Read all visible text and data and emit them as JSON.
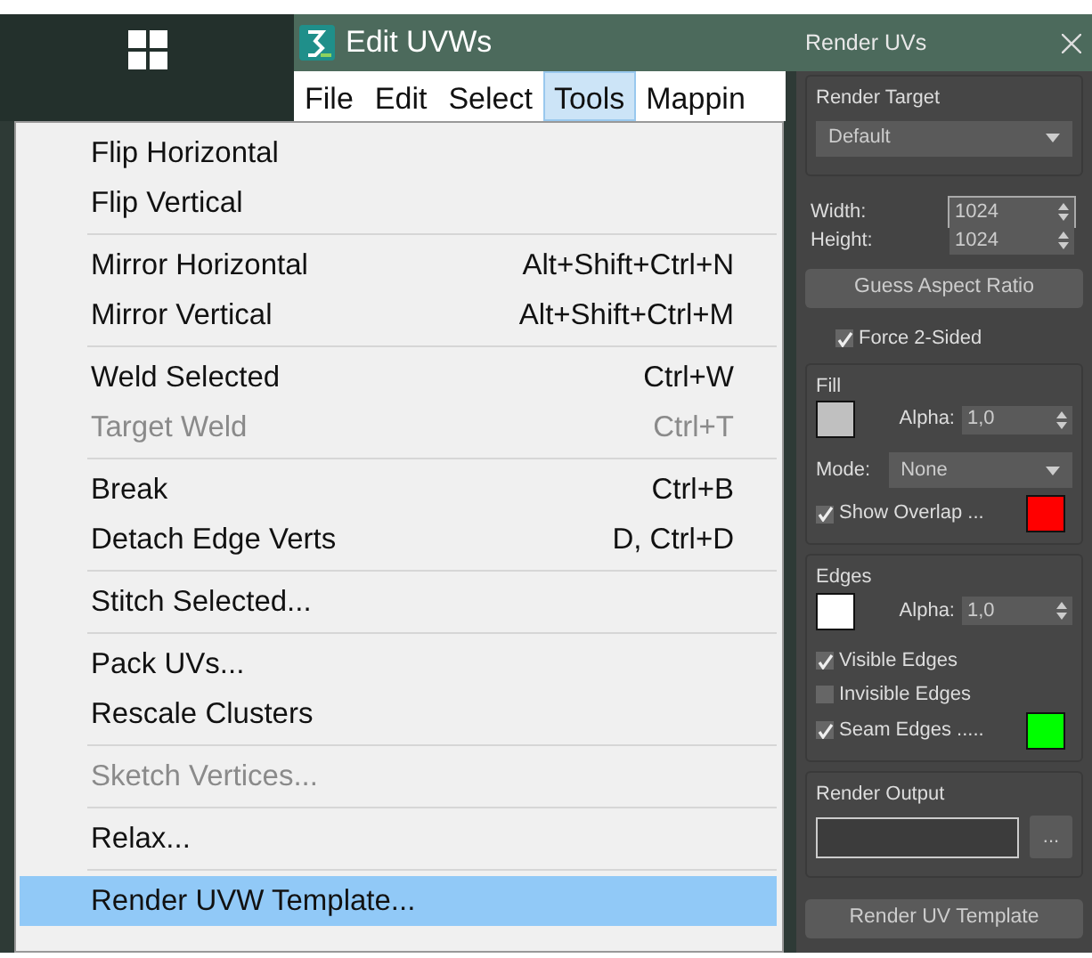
{
  "app_window": {
    "title": "Edit UVWs",
    "menu_bar": [
      {
        "label": "File",
        "selected": false
      },
      {
        "label": "Edit",
        "selected": false
      },
      {
        "label": "Select",
        "selected": false
      },
      {
        "label": "Tools",
        "selected": true
      },
      {
        "label": "Mappin",
        "selected": false
      }
    ]
  },
  "tools_menu": [
    {
      "kind": "item",
      "label": "Flip Horizontal",
      "disabled": false,
      "selected": false
    },
    {
      "kind": "item",
      "label": "Flip Vertical",
      "disabled": false,
      "selected": false
    },
    {
      "kind": "separator"
    },
    {
      "kind": "item",
      "label": "Mirror Horizontal",
      "shortcut": "Alt+Shift+Ctrl+N",
      "disabled": false,
      "selected": false
    },
    {
      "kind": "item",
      "label": "Mirror Vertical",
      "shortcut": "Alt+Shift+Ctrl+M",
      "disabled": false,
      "selected": false
    },
    {
      "kind": "separator"
    },
    {
      "kind": "item",
      "label": "Weld Selected",
      "shortcut": "Ctrl+W",
      "disabled": false,
      "selected": false
    },
    {
      "kind": "item",
      "label": "Target Weld",
      "shortcut": "Ctrl+T",
      "disabled": true,
      "selected": false
    },
    {
      "kind": "separator"
    },
    {
      "kind": "item",
      "label": "Break",
      "shortcut": "Ctrl+B",
      "disabled": false,
      "selected": false
    },
    {
      "kind": "item",
      "label": "Detach Edge Verts",
      "shortcut": "D, Ctrl+D",
      "disabled": false,
      "selected": false
    },
    {
      "kind": "separator"
    },
    {
      "kind": "item",
      "label": "Stitch Selected...",
      "disabled": false,
      "selected": false
    },
    {
      "kind": "separator"
    },
    {
      "kind": "item",
      "label": "Pack UVs...",
      "disabled": false,
      "selected": false
    },
    {
      "kind": "item",
      "label": "Rescale Clusters",
      "disabled": false,
      "selected": false
    },
    {
      "kind": "separator"
    },
    {
      "kind": "item",
      "label": "Sketch Vertices...",
      "disabled": true,
      "selected": false
    },
    {
      "kind": "separator"
    },
    {
      "kind": "item",
      "label": "Relax...",
      "disabled": false,
      "selected": false
    },
    {
      "kind": "separator"
    },
    {
      "kind": "item",
      "label": "Render UVW Template...",
      "disabled": false,
      "selected": true
    }
  ],
  "render_uvs": {
    "title": "Render UVs",
    "render_target": {
      "label": "Render Target",
      "value": "Default"
    },
    "width": {
      "label": "Width:",
      "value": "1024"
    },
    "height": {
      "label": "Height:",
      "value": "1024"
    },
    "guess_button": "Guess Aspect Ratio",
    "force_2_sided": {
      "label": "Force 2-Sided",
      "checked": true
    },
    "fill": {
      "label": "Fill",
      "color": "#c0c0c0",
      "alpha_label": "Alpha:",
      "alpha": "1,0",
      "mode_label": "Mode:",
      "mode": "None",
      "show_overlap": {
        "label": "Show Overlap ...",
        "checked": true,
        "color": "#ff0000"
      }
    },
    "edges": {
      "label": "Edges",
      "color": "#ffffff",
      "alpha_label": "Alpha:",
      "alpha": "1,0",
      "options": [
        {
          "label": "Visible Edges",
          "checked": true
        },
        {
          "label": "Invisible Edges",
          "checked": false
        },
        {
          "label": "Seam Edges .....",
          "checked": true,
          "color": "#00ff00"
        }
      ]
    },
    "render_output": {
      "label": "Render Output",
      "browse": "..."
    },
    "render_button": "Render UV Template"
  }
}
